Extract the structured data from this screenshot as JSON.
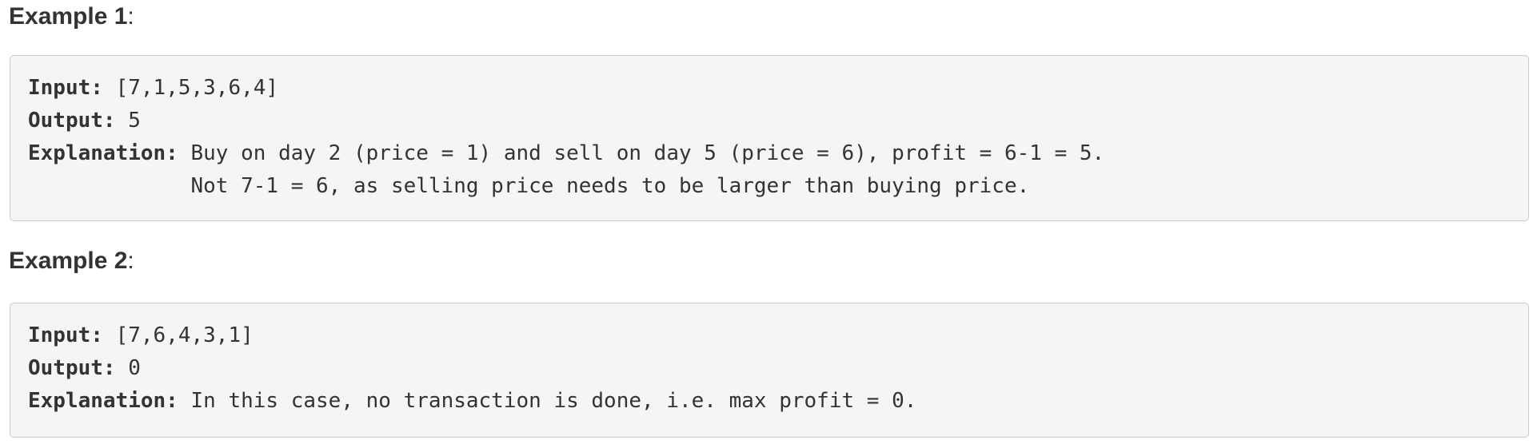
{
  "examples": [
    {
      "heading": "Example 1",
      "heading_suffix": ":",
      "input_label": "Input:",
      "input_value": " [7,1,5,3,6,4]",
      "output_label": "Output:",
      "output_value": " 5",
      "explanation_label": "Explanation:",
      "explanation_lines": [
        " Buy on day 2 (price = 1) and sell on day 5 (price = 6), profit = 6-1 = 5.",
        "             Not 7-1 = 6, as selling price needs to be larger than buying price."
      ]
    },
    {
      "heading": "Example 2",
      "heading_suffix": ":",
      "input_label": "Input:",
      "input_value": " [7,6,4,3,1]",
      "output_label": "Output:",
      "output_value": " 0",
      "explanation_label": "Explanation:",
      "explanation_lines": [
        " In this case, no transaction is done, i.e. max profit = 0."
      ]
    }
  ]
}
